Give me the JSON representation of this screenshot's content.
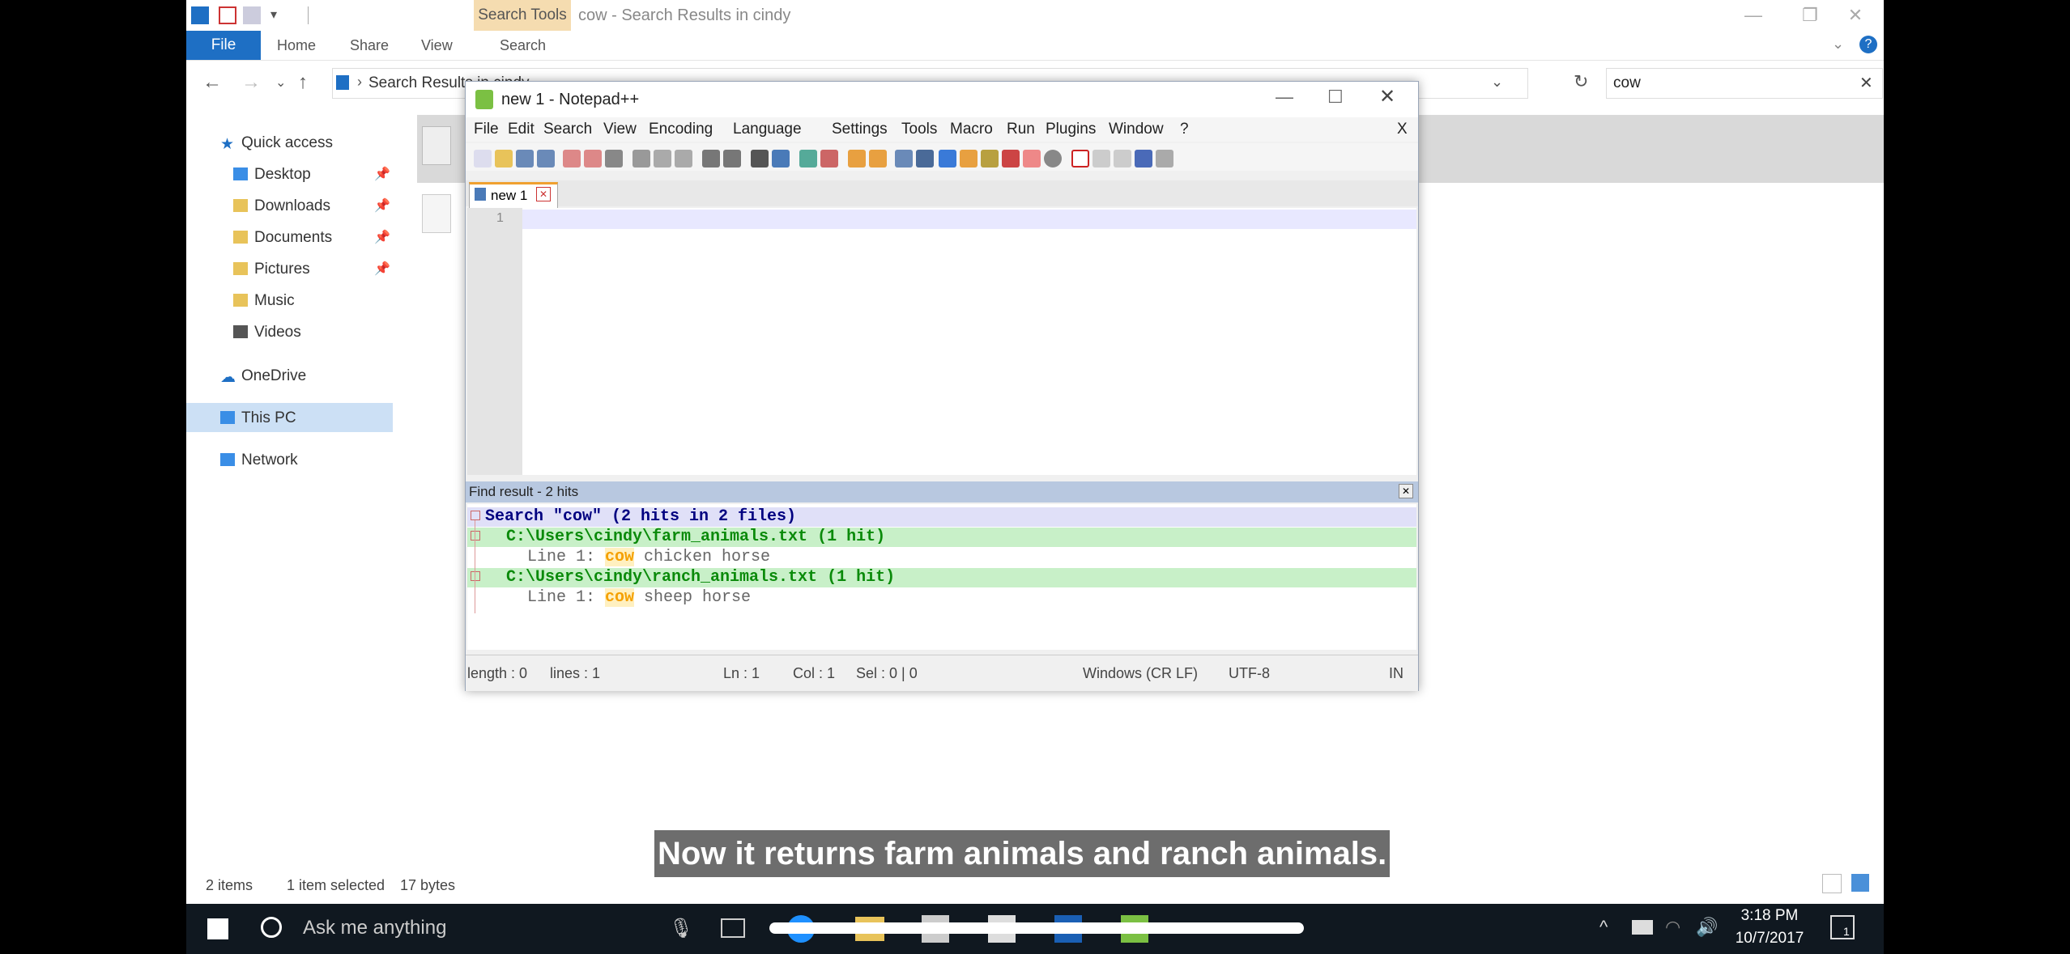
{
  "explorer": {
    "title": "cow - Search Results in cindy",
    "contextual_tab": "Search Tools",
    "ribbon": {
      "file": "File",
      "tabs": [
        "Home",
        "Share",
        "View",
        "Search"
      ]
    },
    "address": "Search Results in cindy",
    "search_value": "cow",
    "nav": {
      "quick_access": "Quick access",
      "items": [
        "Desktop",
        "Downloads",
        "Documents",
        "Pictures",
        "Music",
        "Videos"
      ],
      "onedrive": "OneDrive",
      "this_pc": "This PC",
      "network": "Network"
    },
    "status": {
      "items": "2 items",
      "selected": "1 item selected",
      "size": "17 bytes"
    }
  },
  "notepad": {
    "title": "new 1 - Notepad++",
    "menu": [
      "File",
      "Edit",
      "Search",
      "View",
      "Encoding",
      "Language",
      "Settings",
      "Tools",
      "Macro",
      "Run",
      "Plugins",
      "Window",
      "?"
    ],
    "menu_close": "X",
    "tab": "new 1",
    "line_number": "1",
    "find_header": "Find result - 2 hits",
    "find": {
      "summary": "Search \"cow\" (2 hits in 2 files)",
      "file1": "C:\\Users\\cindy\\farm_animals.txt (1 hit)",
      "line1_prefix": "Line 1: ",
      "line1_hit": "cow",
      "line1_rest": " chicken horse",
      "file2": "C:\\Users\\cindy\\ranch_animals.txt (1 hit)",
      "line2_prefix": "Line 1: ",
      "line2_hit": "cow",
      "line2_rest": " sheep horse"
    },
    "status": {
      "length": "length : 0",
      "lines": "lines : 1",
      "ln": "Ln : 1",
      "col": "Col : 1",
      "sel": "Sel : 0 | 0",
      "eol": "Windows (CR LF)",
      "encoding": "UTF-8",
      "mode": "IN"
    }
  },
  "subtitle": "Now it returns farm animals and ranch animals.",
  "taskbar": {
    "search_placeholder": "Ask me anything",
    "time": "3:18 PM",
    "date": "10/7/2017",
    "notification_count": "1"
  },
  "colors": {
    "accent": "#1e6fc4",
    "hit_yellow": "#f5a000",
    "file_green": "#0a8a0a",
    "file_bg": "#c8f0c8",
    "summary_bg": "#e0e0f8"
  }
}
